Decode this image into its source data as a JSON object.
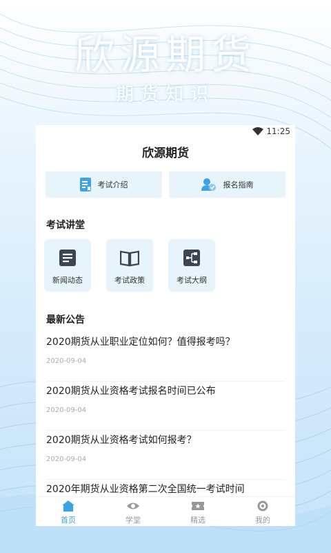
{
  "hero": {
    "title": "欣源期货",
    "subtitle": "期货知识"
  },
  "status_bar": {
    "time": "11:25",
    "wifi_icon": "wifi-icon"
  },
  "app": {
    "title": "欣源期货"
  },
  "quick_actions": [
    {
      "label": "考试介绍",
      "icon": "document-icon"
    },
    {
      "label": "报名指南",
      "icon": "user-check-icon"
    }
  ],
  "lecture_section": {
    "title": "考试讲堂",
    "items": [
      {
        "label": "新闻动态",
        "icon": "news-list-icon"
      },
      {
        "label": "考试政策",
        "icon": "open-book-icon"
      },
      {
        "label": "考试大纲",
        "icon": "outline-tree-icon"
      }
    ]
  },
  "news_section": {
    "title": "最新公告",
    "items": [
      {
        "title": "2020期货从业职业定位如何？值得报考吗？",
        "date": "2020-09-04"
      },
      {
        "title": "2020期货从业资格考试报名时间已公布",
        "date": "2020-09-04"
      },
      {
        "title": "2020期货从业资格考试如何报考？",
        "date": "2020-09-04"
      },
      {
        "title": "2020年期货从业资格第二次全国统一考试时间",
        "date": ""
      }
    ]
  },
  "tabs": [
    {
      "label": "首页",
      "icon": "home-icon",
      "active": true
    },
    {
      "label": "学堂",
      "icon": "eye-icon",
      "active": false
    },
    {
      "label": "精选",
      "icon": "ticket-star-icon",
      "active": false
    },
    {
      "label": "我的",
      "icon": "profile-ring-icon",
      "active": false
    }
  ],
  "colors": {
    "accent": "#3fa2e6",
    "card_background": "#e8f4fb",
    "icon_dark": "#3d4650",
    "tab_inactive": "#999999"
  }
}
